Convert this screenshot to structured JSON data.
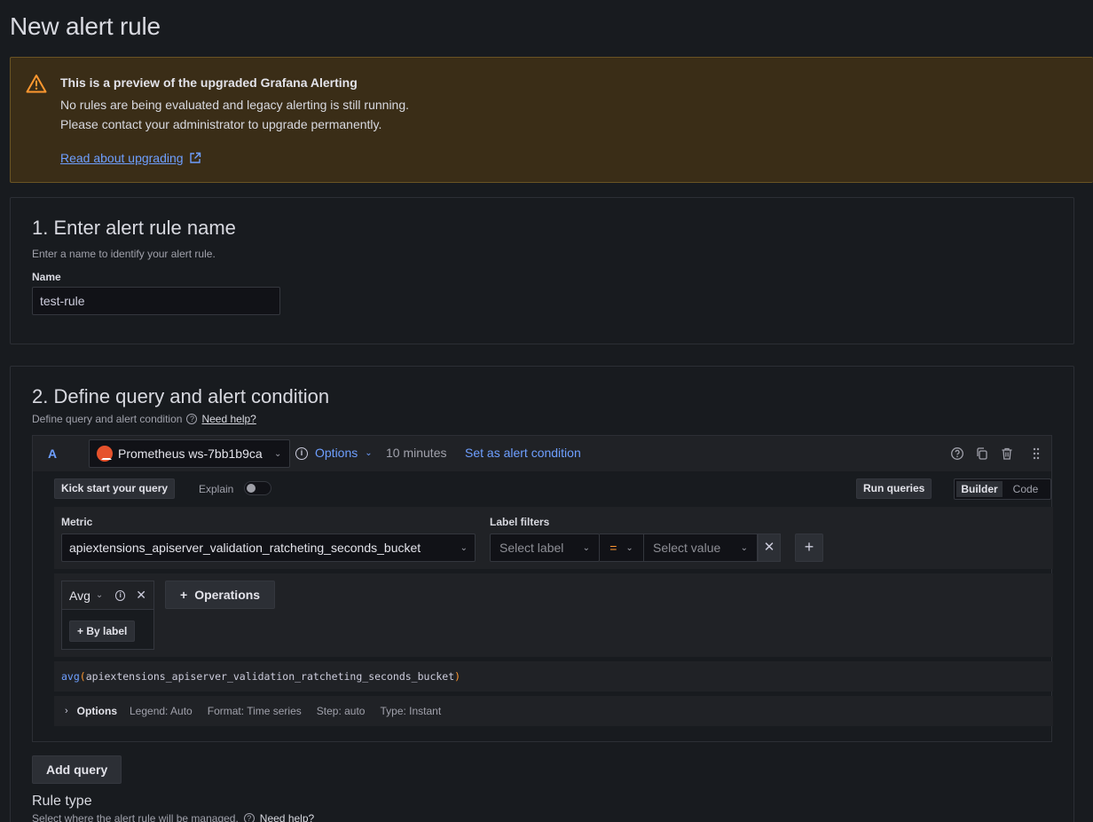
{
  "page": {
    "title": "New alert rule"
  },
  "banner": {
    "title": "This is a preview of the upgraded Grafana Alerting",
    "line1": "No rules are being evaluated and legacy alerting is still running.",
    "line2": "Please contact your administrator to upgrade permanently.",
    "link": "Read about upgrading",
    "accent_color": "#ff9830"
  },
  "step1": {
    "title": "1. Enter alert rule name",
    "subtitle": "Enter a name to identify your alert rule.",
    "name_label": "Name",
    "name_value": "test-rule"
  },
  "step2": {
    "title": "2. Define query and alert condition",
    "subtitle": "Define query and alert condition",
    "help_link": "Need help?",
    "query": {
      "ref_id": "A",
      "datasource": "Prometheus ws-7bb1b9ca",
      "options_label": "Options",
      "interval": "10 minutes",
      "set_condition": "Set as alert condition",
      "kick_start": "Kick start your query",
      "explain_label": "Explain",
      "run_queries": "Run queries",
      "modes": [
        "Builder",
        "Code"
      ],
      "active_mode": "Builder",
      "metric_label": "Metric",
      "metric_value": "apiextensions_apiserver_validation_ratcheting_seconds_bucket",
      "label_filters_label": "Label filters",
      "label_placeholder": "Select label",
      "operator": "=",
      "value_placeholder": "Select value",
      "operation_name": "Avg",
      "by_label": "By label",
      "operations_button": "Operations",
      "preview_fn": "avg",
      "preview_arg": "apiextensions_apiserver_validation_ratcheting_seconds_bucket",
      "options_row": {
        "title": "Options",
        "legend": "Legend: Auto",
        "format": "Format: Time series",
        "step": "Step: auto",
        "type": "Type: Instant"
      }
    },
    "add_query": "Add query",
    "rule_type_title": "Rule type",
    "rule_type_subtitle": "Select where the alert rule will be managed.",
    "rule_type_help": "Need help?"
  },
  "icons": [
    "warning-icon",
    "external-link-icon",
    "prometheus-icon",
    "info-icon",
    "help-icon",
    "duplicate-icon",
    "trash-icon",
    "drag-handle-icon",
    "chevron-down-icon",
    "plus-icon",
    "close-icon",
    "chevron-right-icon"
  ]
}
